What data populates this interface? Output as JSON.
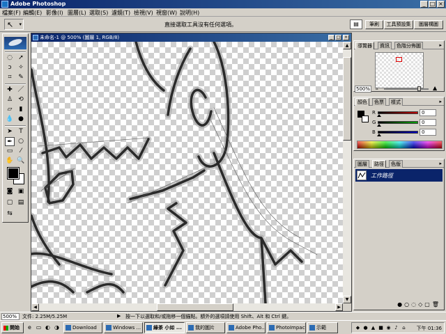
{
  "window": {
    "title": "Adobe Photoshop"
  },
  "menu": [
    "檔案(F)",
    "編輯(E)",
    "影像(I)",
    "圖層(L)",
    "選取(S)",
    "濾鏡(T)",
    "檢視(V)",
    "視窗(W)",
    "說明(H)"
  ],
  "options": {
    "hint": "直接選取工具沒有任何選項。",
    "tabs": [
      "筆刷",
      "工具預設集",
      "圖層構圖"
    ]
  },
  "document": {
    "title": "未命名-1 @ 500% (圖層 1, RGB/8)"
  },
  "navigator": {
    "tabs": [
      "導覽器",
      "資訊",
      "色階分佈圖"
    ],
    "zoom": "500%"
  },
  "color": {
    "tabs": [
      "顏色",
      "色票",
      "樣式"
    ],
    "channels": [
      {
        "label": "R",
        "value": "0",
        "color": "#c00000"
      },
      {
        "label": "G",
        "value": "0",
        "color": "#00a000"
      },
      {
        "label": "B",
        "value": "0",
        "color": "#0000c0"
      }
    ]
  },
  "paths": {
    "tabs": [
      "圖層",
      "路徑",
      "色版"
    ],
    "item": "工作路徑"
  },
  "status": {
    "zoom": "500%",
    "doc": "文件: 2.25M/5.25M",
    "message": "按一下以選取和/或拖移一個錨點。額外的選項請使用 Shift、Alt 和 Ctrl 鍵。"
  },
  "taskbar": {
    "start": "開始",
    "tasks": [
      "Download",
      "Windows ...",
      "綠茶 小如 ...",
      "我的圖片",
      "Adobe Pho...",
      "PhotoImpact",
      "示範"
    ],
    "active_index": 2,
    "clock": "下午 01:36"
  },
  "icons": {
    "titlebar_buttons": [
      "minimize-icon",
      "maximize-icon",
      "close-icon"
    ],
    "tools": [
      "marquee-icon",
      "move-icon",
      "lasso-icon",
      "magic-wand-icon",
      "crop-icon",
      "slice-icon",
      "healing-icon",
      "brush-icon",
      "stamp-icon",
      "history-brush-icon",
      "eraser-icon",
      "gradient-icon",
      "blur-icon",
      "dodge-icon",
      "path-selection-icon",
      "type-icon",
      "pen-icon",
      "shape-icon",
      "notes-icon",
      "eyedropper-icon",
      "hand-icon",
      "zoom-icon"
    ]
  }
}
